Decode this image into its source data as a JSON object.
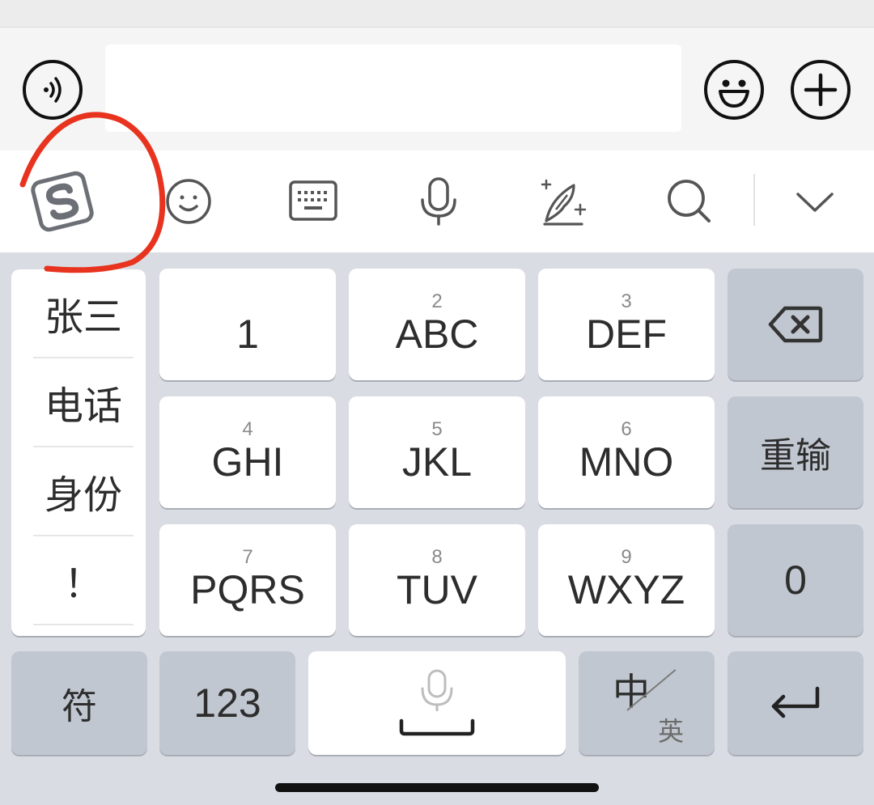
{
  "input_bar": {
    "voice_icon": "voice-wave-icon",
    "text_value": "",
    "emoji_icon": "smiley-face-icon",
    "plus_icon": "plus-circle-icon"
  },
  "toolbar": {
    "items": [
      {
        "name": "sogou-logo-icon",
        "label": "S"
      },
      {
        "name": "emoji-icon"
      },
      {
        "name": "keyboard-icon"
      },
      {
        "name": "microphone-icon"
      },
      {
        "name": "handwriting-quill-icon"
      },
      {
        "name": "search-icon"
      },
      {
        "name": "collapse-chevron-icon"
      }
    ]
  },
  "candidates": [
    "张三",
    "电话",
    "身份",
    "！"
  ],
  "keys": {
    "row1": [
      {
        "num": "",
        "letters": "1"
      },
      {
        "num": "2",
        "letters": "ABC"
      },
      {
        "num": "3",
        "letters": "DEF"
      }
    ],
    "row2": [
      {
        "num": "4",
        "letters": "GHI"
      },
      {
        "num": "5",
        "letters": "JKL"
      },
      {
        "num": "6",
        "letters": "MNO"
      }
    ],
    "row3": [
      {
        "num": "7",
        "letters": "PQRS"
      },
      {
        "num": "8",
        "letters": "TUV"
      },
      {
        "num": "9",
        "letters": "WXYZ"
      }
    ],
    "backspace_icon": "backspace-icon",
    "reinput": "重输",
    "zero": "0",
    "symbols": "符",
    "numbers": "123",
    "space_icon": "microphone-icon",
    "lang_main": "中",
    "lang_sub": "英",
    "enter_icon": "return-arrow-icon"
  },
  "annotation": {
    "color": "#e8331f"
  },
  "colors": {
    "key_light": "#ffffff",
    "key_dark": "#c1c7d0",
    "keyboard_bg": "#d9dde3"
  }
}
